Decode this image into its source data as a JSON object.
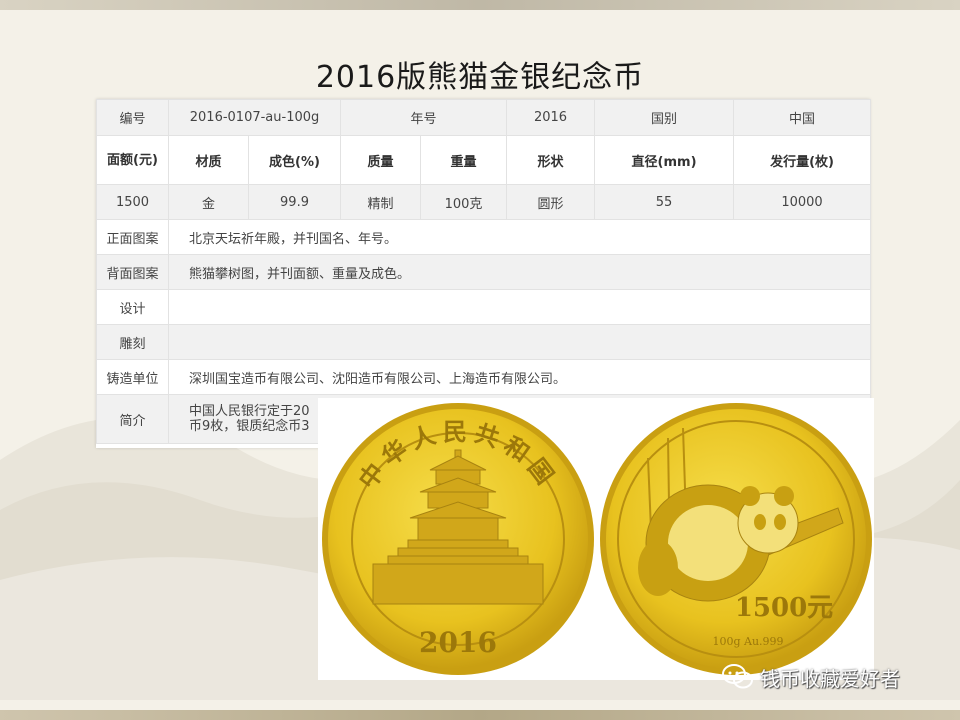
{
  "title": "2016版熊猫金银纪念币",
  "table": {
    "row1": [
      "编号",
      "2016-0107-au-100g",
      "年号",
      "2016",
      "国别",
      "中国"
    ],
    "row2": [
      "面额(元)",
      "材质",
      "成色(%)",
      "质量",
      "重量",
      "形状",
      "直径(mm)",
      "发行量(枚)"
    ],
    "row3": [
      "1500",
      "金",
      "99.9",
      "精制",
      "100克",
      "圆形",
      "55",
      "10000"
    ],
    "rows": [
      {
        "label": "正面图案",
        "value": "北京天坛祈年殿，并刊国名、年号。"
      },
      {
        "label": "背面图案",
        "value": "熊猫攀树图，并刊面额、重量及成色。"
      },
      {
        "label": "设计",
        "value": ""
      },
      {
        "label": "雕刻",
        "value": ""
      },
      {
        "label": "铸造单位",
        "value": "深圳国宝造币有限公司、沈阳造币有限公司、上海造币有限公司。"
      }
    ],
    "intro_label": "简介",
    "intro_line1": "中国人民银行定于20",
    "intro_line2": "币9枚，银质纪念币3"
  },
  "coins": {
    "obverse_legend": "中华人民共和国",
    "obverse_year": "2016",
    "reverse_value": "1500元",
    "reverse_spec": "100g Au.999"
  },
  "watermark": "钱币收藏爱好者",
  "colors": {
    "gold": "#e8c21f",
    "gold_dark": "#b88f10",
    "table_stripe": "#f1f1f1"
  }
}
